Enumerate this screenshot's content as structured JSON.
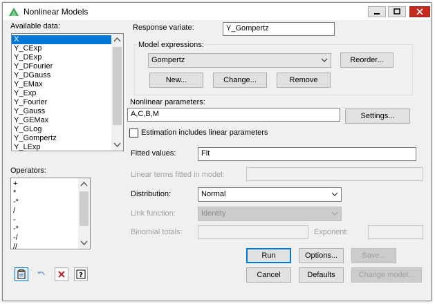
{
  "window": {
    "title": "Nonlinear Models",
    "minimize_icon": "minimize-icon",
    "maximize_icon": "maximize-icon",
    "close_icon": "close-icon"
  },
  "available_data": {
    "label": "Available data:",
    "items": [
      "X",
      "Y_CExp",
      "Y_DExp",
      "Y_DFourier",
      "Y_DGauss",
      "Y_EMax",
      "Y_Exp",
      "Y_Fourier",
      "Y_Gauss",
      "Y_GEMax",
      "Y_GLog",
      "Y_Gompertz",
      "Y_LExp"
    ],
    "selected": "X"
  },
  "operators": {
    "label": "Operators:",
    "items": [
      "+",
      "*",
      "-*",
      "/",
      "-",
      "-*",
      "-/",
      "//"
    ]
  },
  "response": {
    "label": "Response variate:",
    "value": "Y_Gompertz"
  },
  "model_expressions": {
    "label": "Model expressions:",
    "selected": "Gompertz",
    "reorder": "Reorder...",
    "new": "New...",
    "change": "Change...",
    "remove": "Remove"
  },
  "nonlinear": {
    "label": "Nonlinear parameters:",
    "value": "A,C,B,M",
    "settings": "Settings..."
  },
  "estimation": {
    "label": "Estimation includes linear parameters",
    "checked": false
  },
  "fitted": {
    "label": "Fitted values:",
    "value": "Fit"
  },
  "linear_terms": {
    "label": "Linear terms fitted in model:",
    "value": ""
  },
  "distribution": {
    "label": "Distribution:",
    "value": "Normal"
  },
  "link": {
    "label": "Link function:",
    "value": "Identity"
  },
  "binomial": {
    "label": "Binomial totals:",
    "value": ""
  },
  "exponent": {
    "label": "Exponent:",
    "value": ""
  },
  "buttons": {
    "run": "Run",
    "options": "Options...",
    "save": "Save...",
    "cancel": "Cancel",
    "defaults": "Defaults",
    "change_model": "Change model..."
  },
  "toolbar": {
    "copy_icon": "clipboard-icon",
    "undo_icon": "undo-icon",
    "clear_icon": "clear-icon",
    "help_icon": "help-icon"
  },
  "colors": {
    "selection": "#0078d7",
    "close": "#c42b1c"
  }
}
